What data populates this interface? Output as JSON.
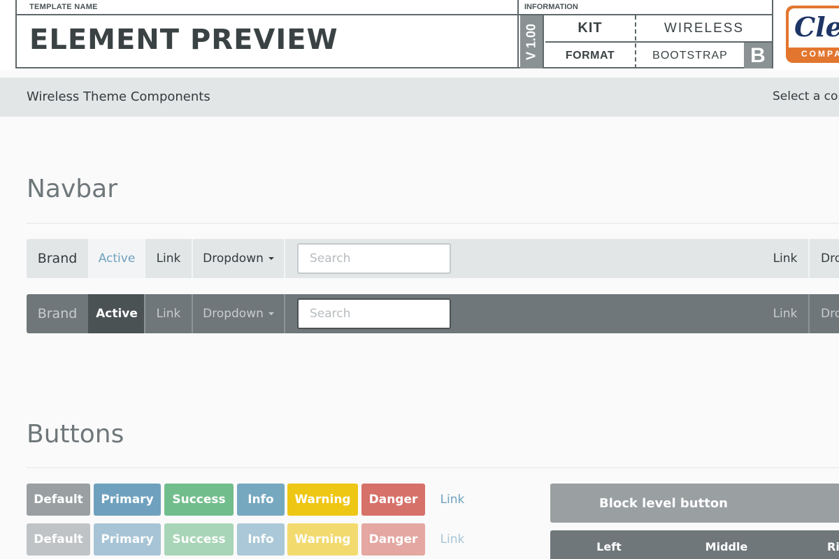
{
  "header": {
    "template_label": "TEMPLATE NAME",
    "title": "ELEMENT PREVIEW",
    "info_label": "INFORMATION",
    "version": "V 1.00",
    "kit": "KIT",
    "kit_value": "WIRELESS",
    "format": "FORMAT",
    "format_value": "BOOTSTRAP",
    "bootstrap_icon": "B",
    "logo_script": "Clev",
    "logo_sub": "COMPA"
  },
  "subbar": {
    "title": "Wireless Theme Components",
    "right_text": "Select a con"
  },
  "sections": {
    "navbar": "Navbar",
    "buttons": "Buttons"
  },
  "navbar": {
    "brand": "Brand",
    "active": "Active",
    "link": "Link",
    "dropdown": "Dropdown",
    "search_placeholder": "Search",
    "right_link": "Link",
    "right_dropdown": "Dro"
  },
  "buttons": {
    "default": "Default",
    "primary": "Primary",
    "success": "Success",
    "info": "Info",
    "warning": "Warning",
    "danger": "Danger",
    "link": "Link",
    "block": "Block level button",
    "group_left": "Left",
    "group_middle": "Middle",
    "group_right": "Ri"
  },
  "colors": {
    "default": "#9aa0a2",
    "primary": "#6fa1be",
    "success": "#72bd8c",
    "info": "#76a8c0",
    "warning": "#eec614",
    "danger": "#d67169",
    "link": "#6fa1be",
    "navbar_light": "#e3e6e7",
    "navbar_dark": "#6f777a"
  }
}
